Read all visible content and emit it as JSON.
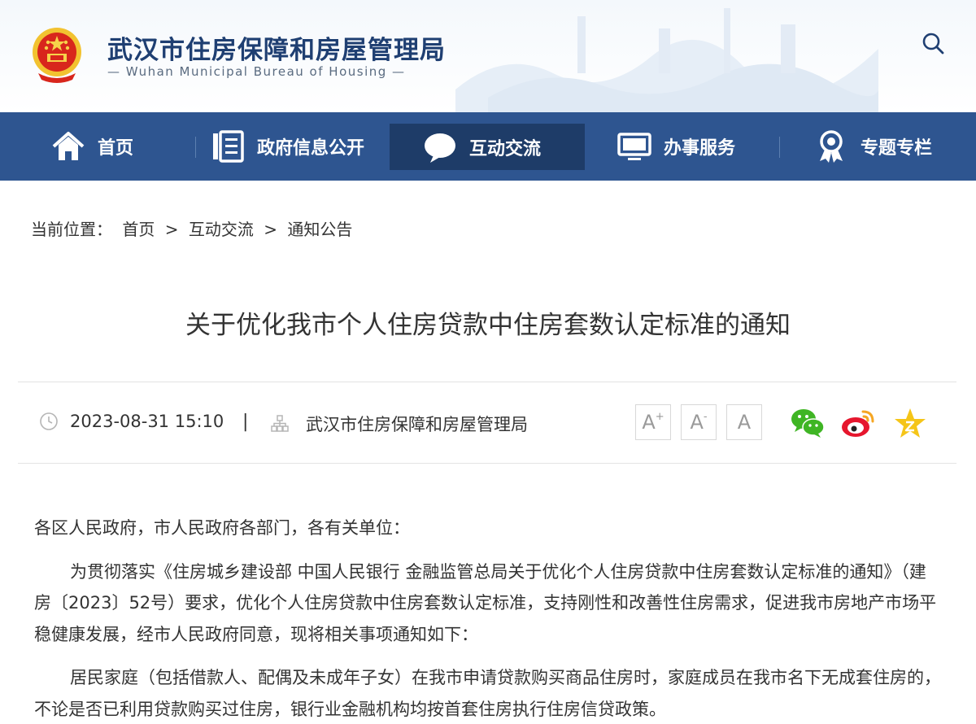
{
  "header": {
    "site_title": "武汉市住房保障和房屋管理局",
    "site_subtitle": "— Wuhan Municipal Bureau of Housing —",
    "icons": {
      "emblem": "national-emblem-icon",
      "search": "search-icon"
    }
  },
  "nav": {
    "items": [
      {
        "label": "首页",
        "icon": "home-icon"
      },
      {
        "label": "政府信息公开",
        "icon": "document-list-icon"
      },
      {
        "label": "互动交流",
        "icon": "chat-bubble-icon",
        "active": true
      },
      {
        "label": "办事服务",
        "icon": "monitor-icon"
      },
      {
        "label": "专题专栏",
        "icon": "ribbon-award-icon"
      }
    ],
    "colors": {
      "background": "#2e5590",
      "active": "#1e3c68"
    }
  },
  "breadcrumb": {
    "prefix": "当前位置：",
    "items": [
      "首页",
      "互动交流",
      "通知公告"
    ],
    "separator": ">"
  },
  "article": {
    "title": "关于优化我市个人住房贷款中住房套数认定标准的通知",
    "meta": {
      "datetime": "2023-08-31 15:10",
      "divider": "|",
      "source": "武汉市住房保障和房屋管理局"
    },
    "font_size_buttons": {
      "increase": "A",
      "increase_sup": "+",
      "decrease": "A",
      "decrease_sup": "-",
      "reset": "A"
    },
    "share": {
      "wechat": "wechat-icon",
      "weibo": "weibo-icon",
      "favorite": "favorite-star-icon"
    },
    "paragraphs": [
      "各区人民政府，市人民政府各部门，各有关单位：",
      "为贯彻落实《住房城乡建设部 中国人民银行 金融监管总局关于优化个人住房贷款中住房套数认定标准的通知》（建房〔2023〕52号）要求，优化个人住房贷款中住房套数认定标准，支持刚性和改善性住房需求，促进我市房地产市场平稳健康发展，经市人民政府同意，现将相关事项通知如下：",
      "居民家庭（包括借款人、配偶及未成年子女）在我市申请贷款购买商品住房时，家庭成员在我市名下无成套住房的，不论是否已利用贷款购买过住房，银行业金融机构均按首套住房执行住房信贷政策。"
    ]
  }
}
